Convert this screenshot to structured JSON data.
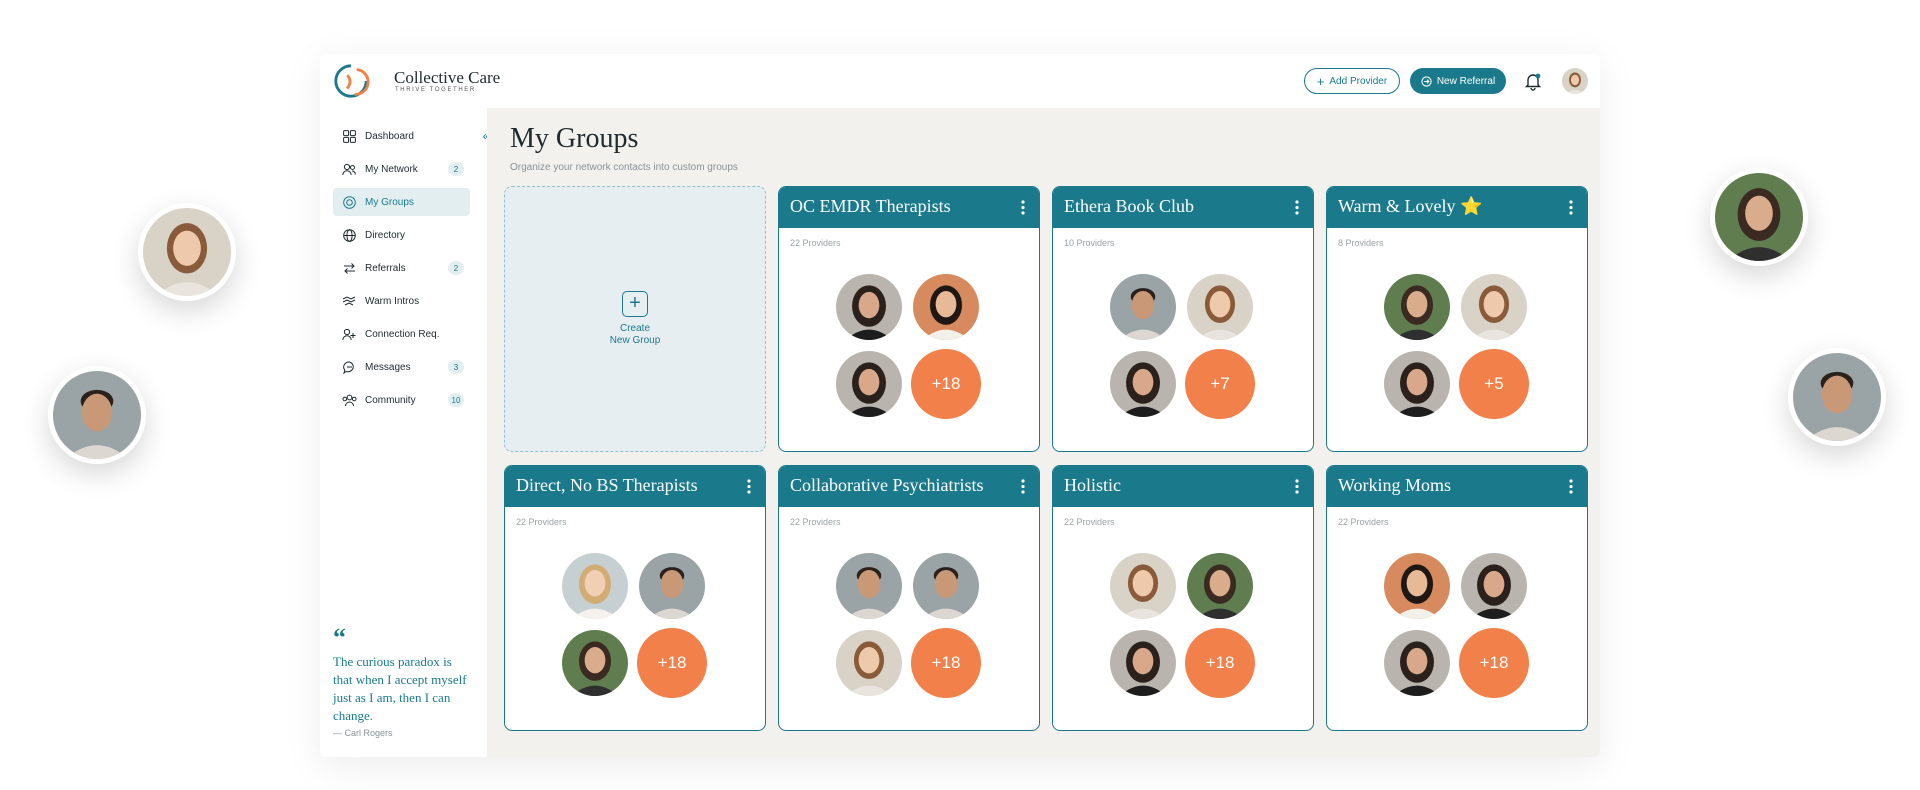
{
  "brand": {
    "name": "Collective Care",
    "tagline": "THRIVE TOGETHER",
    "accent": "#1a7a8c",
    "secondary": "#f2804a"
  },
  "header": {
    "add_provider_label": "Add Provider",
    "new_referral_label": "New Referral",
    "icons": [
      "plus-icon",
      "referral-icon",
      "bell-icon"
    ]
  },
  "sidebar": {
    "collapse_icon": "double-chevron-left-icon",
    "items": [
      {
        "label": "Dashboard",
        "badge": "",
        "icon": "grid-icon"
      },
      {
        "label": "My Network",
        "badge": "2",
        "icon": "users-icon"
      },
      {
        "label": "My Groups",
        "badge": "",
        "icon": "target-icon",
        "active": true
      },
      {
        "label": "Directory",
        "badge": "",
        "icon": "globe-icon"
      },
      {
        "label": "Referrals",
        "badge": "2",
        "icon": "arrows-icon"
      },
      {
        "label": "Warm Intros",
        "badge": "",
        "icon": "handshake-icon"
      },
      {
        "label": "Connection Req.",
        "badge": "",
        "icon": "user-plus-icon"
      },
      {
        "label": "Messages",
        "badge": "3",
        "icon": "chat-icon"
      },
      {
        "label": "Community",
        "badge": "10",
        "icon": "community-icon"
      }
    ],
    "quote": {
      "text": "The curious paradox is that when I accept myself just as I am, then I can change.",
      "author": "— Carl Rogers"
    }
  },
  "main": {
    "title": "My Groups",
    "subtitle": "Organize your network contacts into custom groups",
    "create": {
      "line1": "Create",
      "line2": "New Group"
    },
    "groups": [
      {
        "title": "OC EMDR Therapists",
        "count": "22 Providers",
        "more": "+18"
      },
      {
        "title": "Ethera Book Club",
        "count": "10 Providers",
        "more": "+7"
      },
      {
        "title": "Warm & Lovely ⭐",
        "count": "8 Providers",
        "more": "+5"
      },
      {
        "title": "Direct, No BS Therapists",
        "count": "22 Providers",
        "more": "+18"
      },
      {
        "title": "Collaborative Psychiatrists",
        "count": "22 Providers",
        "more": "+18"
      },
      {
        "title": "Holistic",
        "count": "22 Providers",
        "more": "+18"
      },
      {
        "title": "Working Moms",
        "count": "22 Providers",
        "more": "+18"
      }
    ]
  }
}
